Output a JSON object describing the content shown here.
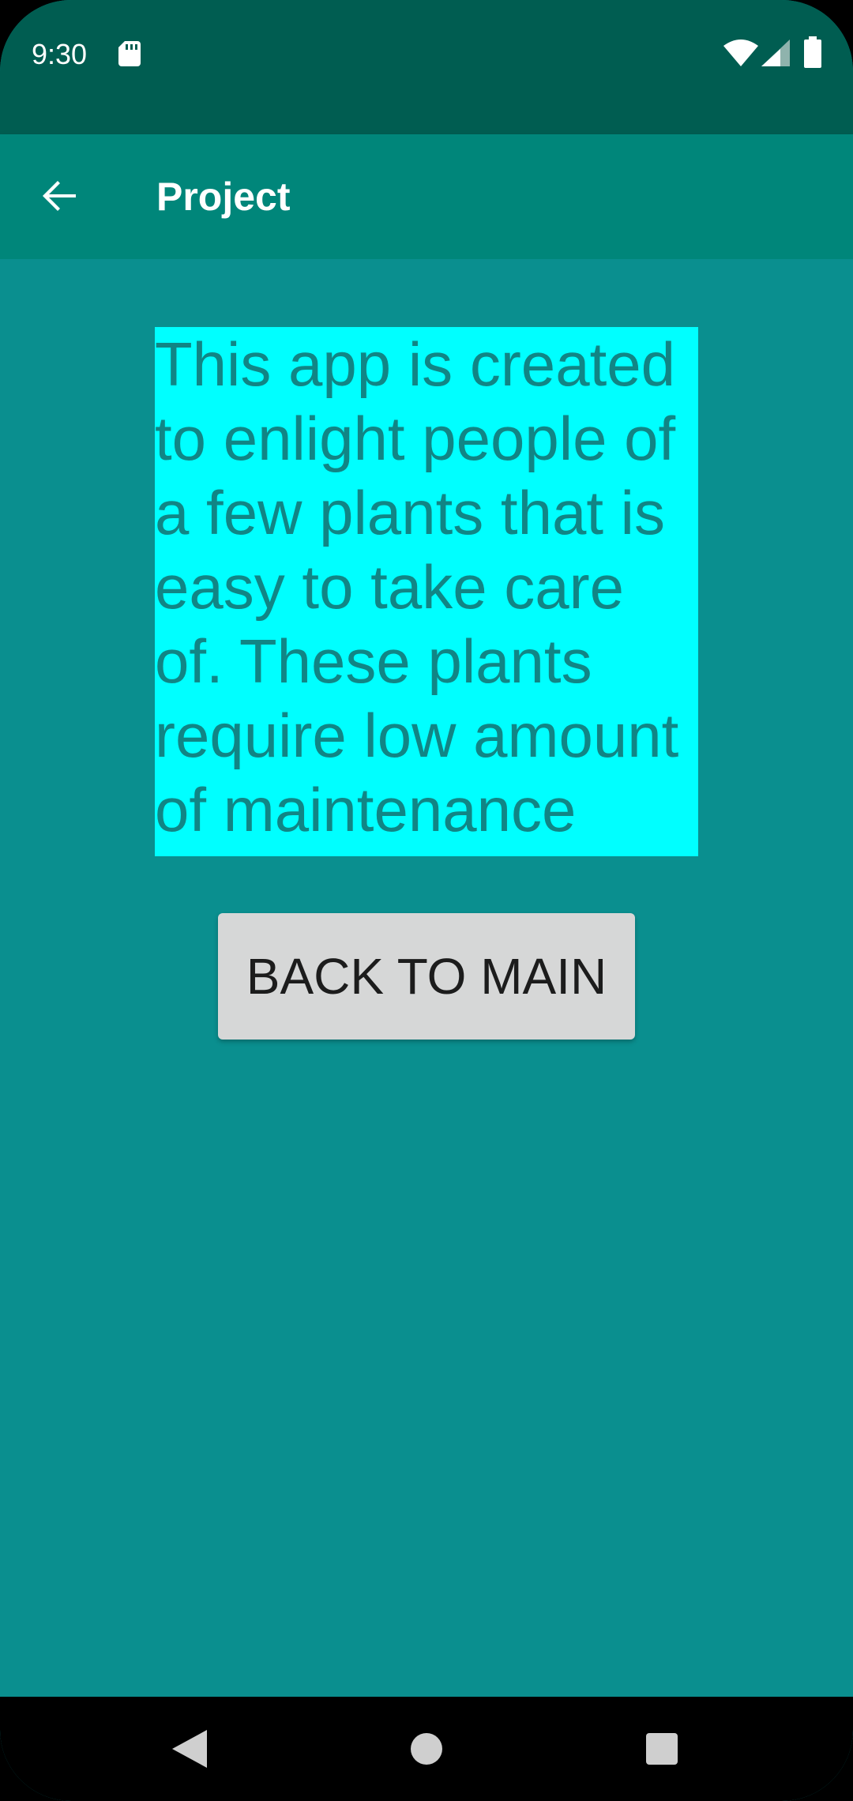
{
  "status_bar": {
    "time": "9:30",
    "icons": [
      "sd-card-icon",
      "wifi-icon",
      "signal-icon",
      "battery-icon"
    ]
  },
  "app_bar": {
    "title": "Project",
    "nav_icon": "back-arrow-icon"
  },
  "content": {
    "description": "This app is created\nto enlight people of\na few plants that is\neasy to take care\nof. These plants\nrequire low amount\nof maintenance",
    "button_label": "BACK TO MAIN"
  },
  "nav_bar": {
    "icons": [
      "nav-back-icon",
      "nav-home-icon",
      "nav-recents-icon"
    ]
  },
  "colors": {
    "status_bar": "#005d51",
    "app_bar": "#00867a",
    "background": "#0a8f8f",
    "text_highlight": "#00ffff",
    "text_color": "#118585",
    "button": "#d6d7d7"
  }
}
